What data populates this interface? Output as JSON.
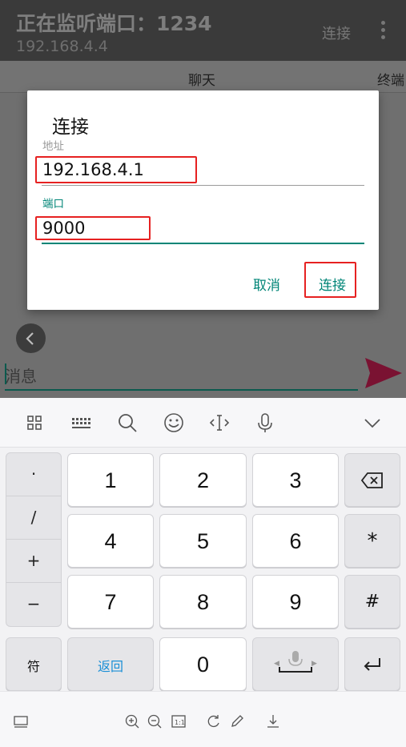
{
  "app": {
    "title": "正在监听端口：1234",
    "subtitle": "192.168.4.4",
    "connect_action": "连接",
    "tabs": [
      "聊天",
      "终端"
    ],
    "message_placeholder": "消息"
  },
  "dialog": {
    "title": "连接",
    "address_label": "地址",
    "address_value": "192.168.4.1",
    "port_label": "端口",
    "port_value": "9000",
    "cancel_label": "取消",
    "confirm_label": "连接"
  },
  "keyboard": {
    "toolbar_icons": [
      "grid-icon",
      "keyboard-icon",
      "search-icon",
      "emoji-icon",
      "cursor-icon",
      "microphone-icon",
      "chevron-down-icon"
    ],
    "symbols": [
      "·",
      "/",
      "+",
      "−"
    ],
    "digits": [
      "1",
      "2",
      "3",
      "4",
      "5",
      "6",
      "7",
      "8",
      "9",
      "0"
    ],
    "right_keys": [
      "backspace-icon",
      "*",
      "#",
      "enter-icon"
    ],
    "symbol_key": "符",
    "return_key": "返回"
  },
  "colors": {
    "accent": "#008577",
    "highlight": "#e62121",
    "send": "#7a1232"
  }
}
